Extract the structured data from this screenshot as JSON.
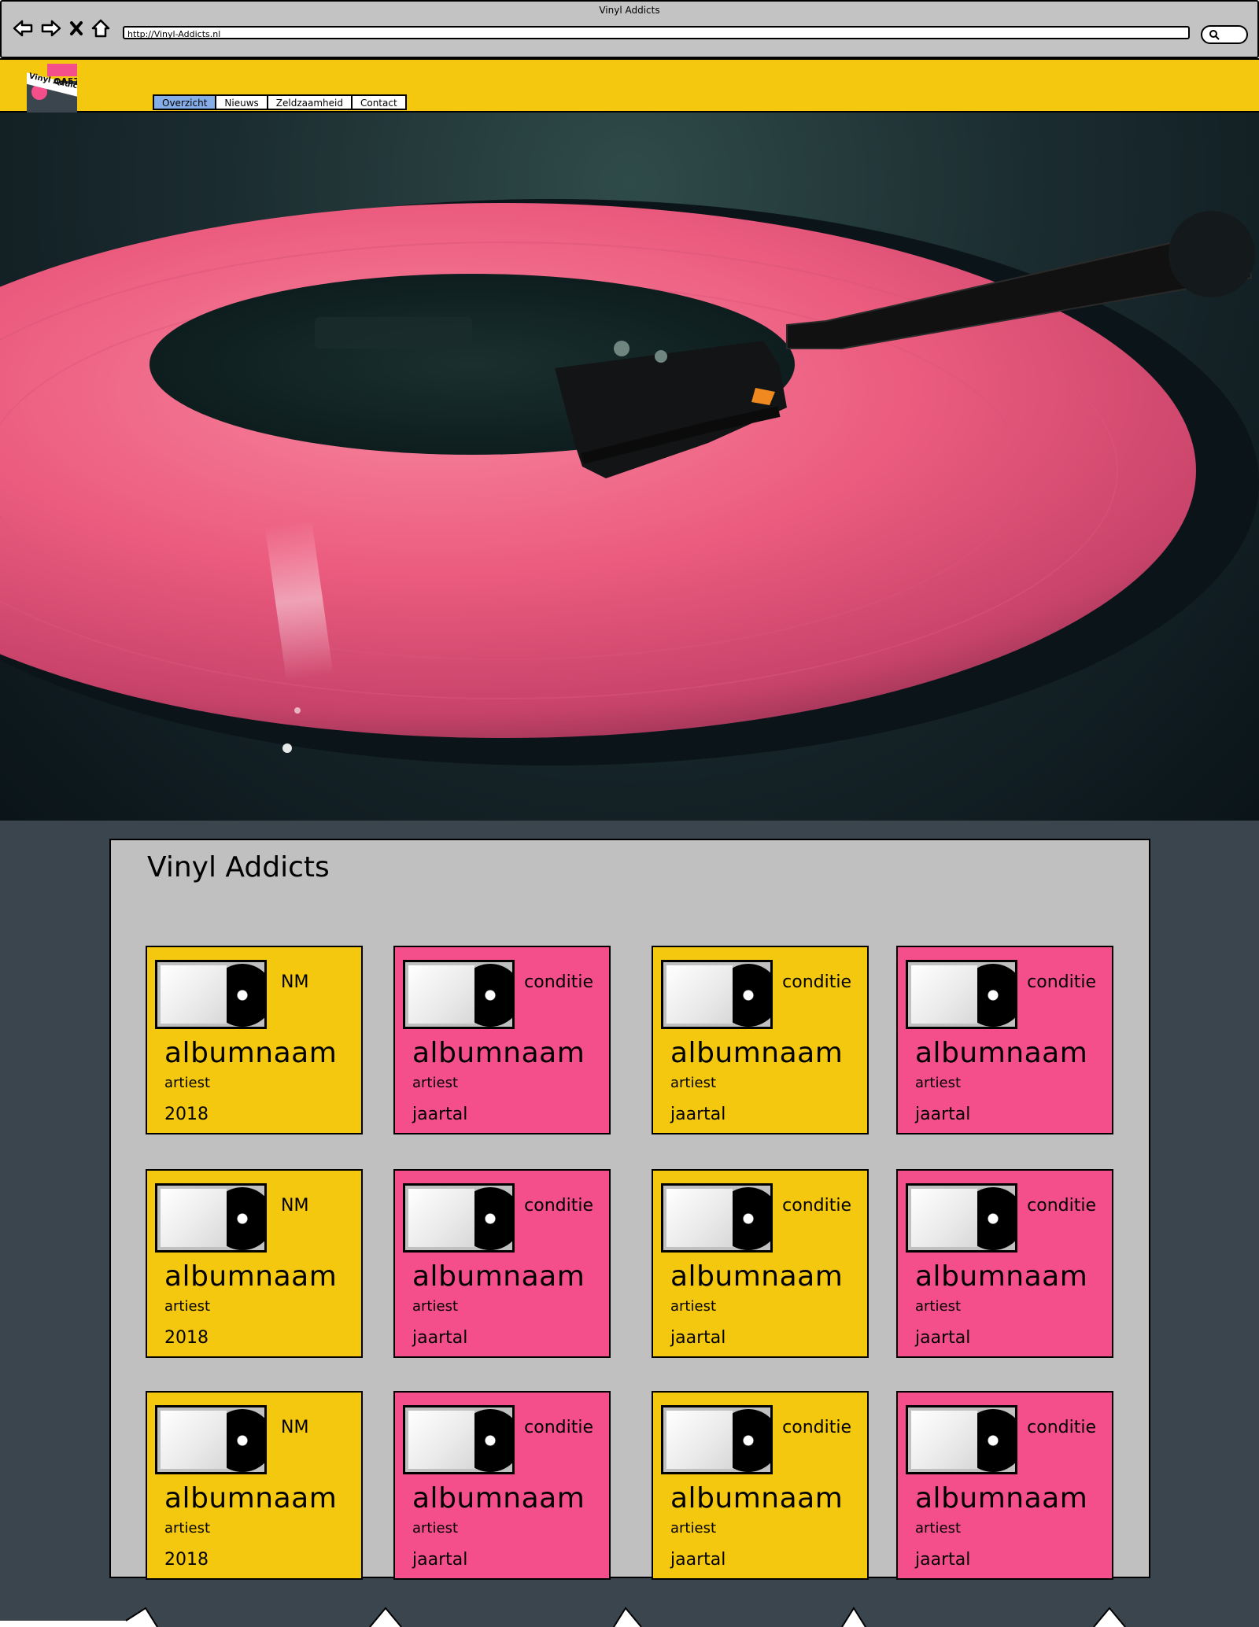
{
  "browser": {
    "window_title": "Vinyl Addicts",
    "url": "http://Vinyl-Addicts.nl",
    "nav_icons": [
      "back-arrow-icon",
      "forward-arrow-icon",
      "close-icon",
      "home-icon"
    ],
    "search_icon": "search-icon"
  },
  "header": {
    "logo_text": "Vinyl Addicts",
    "logo_number": "QA5750",
    "tabs": [
      {
        "label": "Overzicht",
        "active": true
      },
      {
        "label": "Nieuws",
        "active": false
      },
      {
        "label": "Zeldzaamheid",
        "active": false
      },
      {
        "label": "Contact",
        "active": false
      }
    ]
  },
  "main": {
    "title": "Vinyl Addicts",
    "cards": [
      {
        "color": "yellow",
        "condition": "NM",
        "album": "albumnaam",
        "artist": "artiest",
        "year": "2018"
      },
      {
        "color": "pink",
        "condition": "conditie",
        "album": "albumnaam",
        "artist": "artiest",
        "year": "jaartal"
      },
      {
        "color": "yellow",
        "condition": "conditie",
        "album": "albumnaam",
        "artist": "artiest",
        "year": "jaartal"
      },
      {
        "color": "pink",
        "condition": "conditie",
        "album": "albumnaam",
        "artist": "artiest",
        "year": "jaartal"
      },
      {
        "color": "yellow",
        "condition": "NM",
        "album": "albumnaam",
        "artist": "artiest",
        "year": "2018"
      },
      {
        "color": "pink",
        "condition": "conditie",
        "album": "albumnaam",
        "artist": "artiest",
        "year": "jaartal"
      },
      {
        "color": "yellow",
        "condition": "conditie",
        "album": "albumnaam",
        "artist": "artiest",
        "year": "jaartal"
      },
      {
        "color": "pink",
        "condition": "conditie",
        "album": "albumnaam",
        "artist": "artiest",
        "year": "jaartal"
      },
      {
        "color": "yellow",
        "condition": "NM",
        "album": "albumnaam",
        "artist": "artiest",
        "year": "2018"
      },
      {
        "color": "pink",
        "condition": "conditie",
        "album": "albumnaam",
        "artist": "artiest",
        "year": "jaartal"
      },
      {
        "color": "yellow",
        "condition": "conditie",
        "album": "albumnaam",
        "artist": "artiest",
        "year": "jaartal"
      },
      {
        "color": "pink",
        "condition": "conditie",
        "album": "albumnaam",
        "artist": "artiest",
        "year": "jaartal"
      }
    ]
  },
  "colors": {
    "header_yellow": "#f5c810",
    "card_pink": "#f44f8a",
    "panel_gray": "#c0c0c0",
    "page_slate": "#3a454e",
    "tab_active": "#85aee8"
  }
}
